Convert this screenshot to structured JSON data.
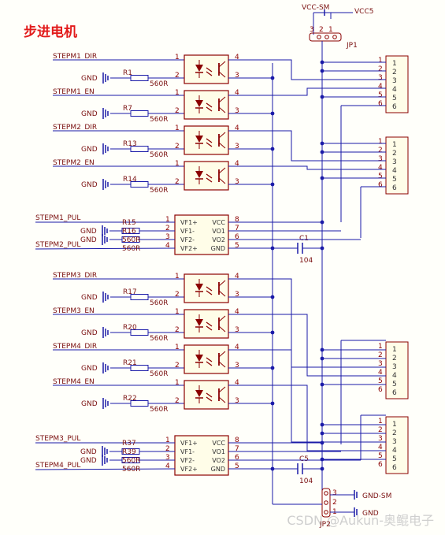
{
  "title": "步进电机",
  "watermark": "CSDN @Aukun-奥鲲电子",
  "colors": {
    "wire": "#1a1aa8",
    "text": "#8b0000",
    "label": "#7a1010",
    "part": "#8b0000",
    "body": "#fffde8",
    "title": "#e21b1b"
  },
  "vcc": {
    "net": "VCC-SM",
    "power": "VCC5",
    "header": "JP1"
  },
  "gnd": {
    "net": "GND-SM",
    "power": "GND",
    "header": "JP2"
  },
  "ground_label": "GND",
  "optos": [
    {
      "input": "STEPM1_DIR",
      "resistor": "R1",
      "value": "560R"
    },
    {
      "input": "STEPM1_EN",
      "resistor": "R7",
      "value": "560R"
    },
    {
      "input": "STEPM2_DIR",
      "resistor": "R13",
      "value": "560R"
    },
    {
      "input": "STEPM2_EN",
      "resistor": "R14",
      "value": "560R"
    },
    {
      "input": "STEPM3_DIR",
      "resistor": "R17",
      "value": "560R"
    },
    {
      "input": "STEPM3_EN",
      "resistor": "R20",
      "value": "560R"
    },
    {
      "input": "STEPM4_DIR",
      "resistor": "R21",
      "value": "560R"
    },
    {
      "input": "STEPM4_EN",
      "resistor": "R22",
      "value": "560R"
    }
  ],
  "dual": [
    {
      "inputs": [
        "STEPM1_PUL",
        "STEPM2_PUL"
      ],
      "resistors": [
        "R15",
        "R16",
        "560R",
        "560R"
      ],
      "cap": "C1",
      "cap_value": "104"
    },
    {
      "inputs": [
        "STEPM3_PUL",
        "STEPM4_PUL"
      ],
      "resistors": [
        "R37",
        "R39",
        "560R",
        "560R"
      ],
      "cap": "C5",
      "cap_value": "104"
    }
  ],
  "dual_pins_left": [
    "VF1+",
    "VF1-",
    "VF2-",
    "VF2+"
  ],
  "dual_pins_right": [
    "VCC",
    "VO1",
    "VO2",
    "GND"
  ],
  "dual_pin_numbers_left": [
    "1",
    "2",
    "3",
    "4"
  ],
  "dual_pin_numbers_right": [
    "8",
    "7",
    "6",
    "5"
  ],
  "opto_pin_numbers": [
    "1",
    "2",
    "4",
    "3"
  ],
  "connector_pins": [
    "1",
    "2",
    "3",
    "4",
    "5",
    "6"
  ],
  "header_pins": [
    "3",
    "2",
    "1"
  ]
}
